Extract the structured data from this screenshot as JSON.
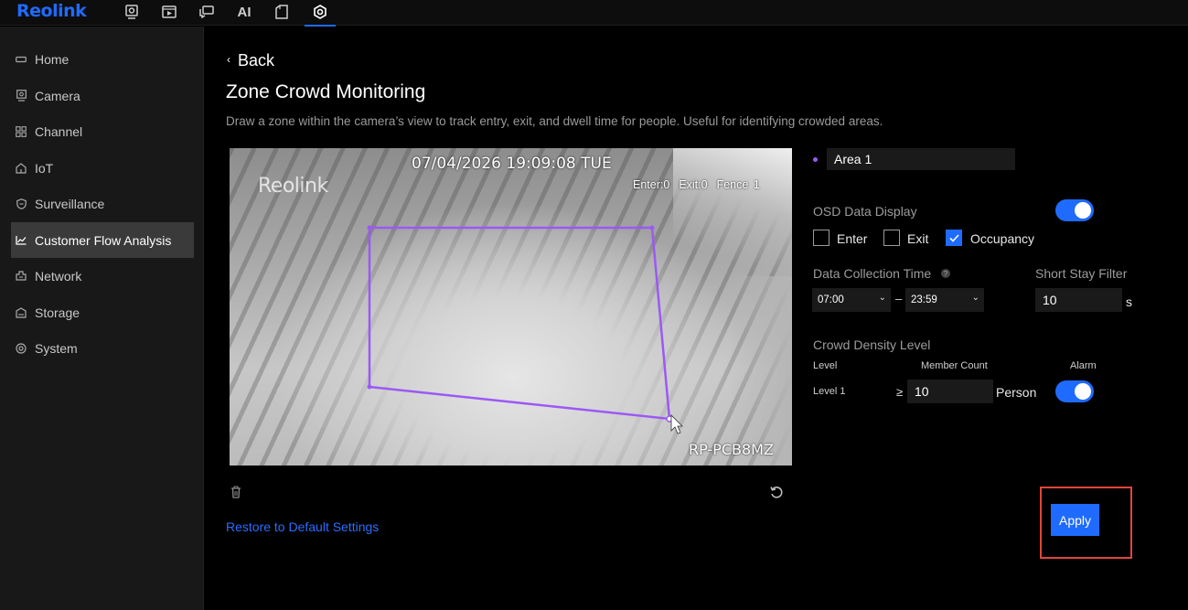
{
  "app": {
    "logo": "Reolink"
  },
  "topnav": {
    "icons": [
      "camera-preview-icon",
      "playback-icon",
      "messages-icon",
      "ai-icon",
      "files-icon",
      "settings-icon"
    ],
    "ai_label": "AI",
    "active": "settings-icon"
  },
  "sidebar": {
    "items": [
      {
        "label": "Home",
        "icon": "home-icon"
      },
      {
        "label": "Camera",
        "icon": "camera-icon"
      },
      {
        "label": "Channel",
        "icon": "channel-icon"
      },
      {
        "label": "IoT",
        "icon": "iot-icon"
      },
      {
        "label": "Surveillance",
        "icon": "shield-icon"
      },
      {
        "label": "Customer Flow Analysis",
        "icon": "chart-icon",
        "active": true
      },
      {
        "label": "Network",
        "icon": "network-icon"
      },
      {
        "label": "Storage",
        "icon": "storage-icon"
      },
      {
        "label": "System",
        "icon": "gear-icon"
      }
    ]
  },
  "main": {
    "back_label": "Back",
    "title": "Zone Crowd Monitoring",
    "description": "Draw a zone within the camera’s view to track entry, exit, and dwell time for people. Useful for identifying crowded areas.",
    "video": {
      "timestamp": "07/04/2026 19:09:08 TUE",
      "watermark": "Reolink",
      "enter": "Enter:0",
      "exit": "Exit:0",
      "fence": "Fence 1",
      "camera_name": "RP-PCB8MZ",
      "zone_color": "#9b59f5"
    },
    "restore_label": "Restore to Default Settings"
  },
  "panel": {
    "area_name": "Area 1",
    "osd_label": "OSD Data Display",
    "osd_enabled": true,
    "checkboxes": [
      {
        "label": "Enter",
        "checked": false
      },
      {
        "label": "Exit",
        "checked": false
      },
      {
        "label": "Occupancy",
        "checked": true
      }
    ],
    "collection_label": "Data Collection Time",
    "start_time": "07:00",
    "end_time": "23:59",
    "dash": "–",
    "short_stay_label": "Short Stay Filter",
    "short_stay_value": "10",
    "short_stay_unit": "s",
    "density_label": "Crowd Density Level",
    "columns": {
      "level": "Level",
      "member_count": "Member Count",
      "alarm": "Alarm"
    },
    "levels": [
      {
        "name": "Level 1",
        "operator": "≥",
        "count": "10",
        "unit": "Person",
        "alarm": true
      }
    ],
    "apply_label": "Apply"
  },
  "colors": {
    "accent": "#1f6bff",
    "highlight": "#e0463a",
    "zone": "#9b59f5"
  }
}
